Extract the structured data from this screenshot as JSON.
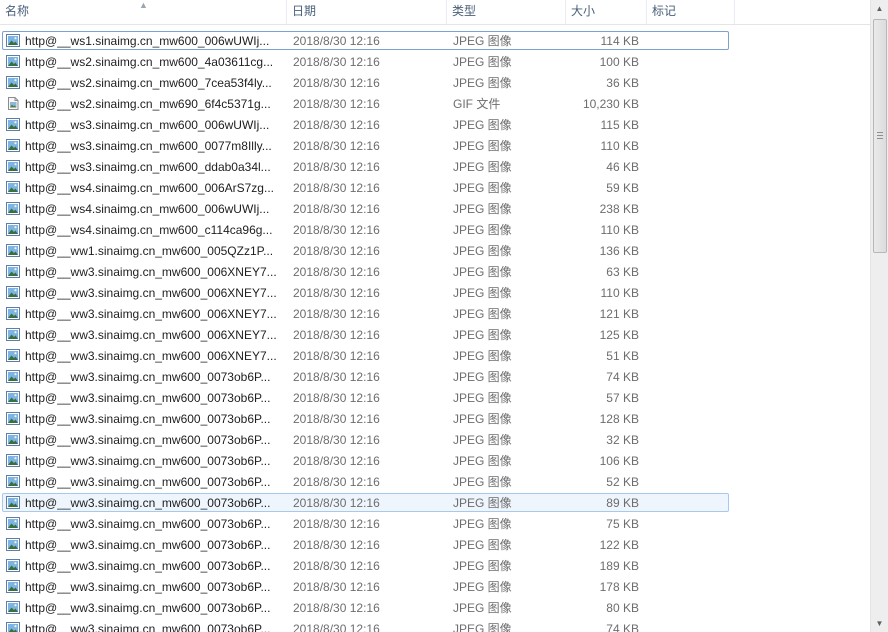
{
  "columns": {
    "name": "名称",
    "date": "日期",
    "type": "类型",
    "size": "大小",
    "tags": "标记"
  },
  "rows": [
    {
      "name": "http@__ws1.sinaimg.cn_mw600_006wUWIj...",
      "date": "2018/8/30 12:16",
      "type": "JPEG 图像",
      "size": "114 KB",
      "icon": "jpeg-image-icon",
      "state": "selected"
    },
    {
      "name": "http@__ws2.sinaimg.cn_mw600_4a03611cg...",
      "date": "2018/8/30 12:16",
      "type": "JPEG 图像",
      "size": "100 KB",
      "icon": "jpeg-image-icon"
    },
    {
      "name": "http@__ws2.sinaimg.cn_mw600_7cea53f4ly...",
      "date": "2018/8/30 12:16",
      "type": "JPEG 图像",
      "size": "36 KB",
      "icon": "jpeg-image-icon"
    },
    {
      "name": "http@__ws2.sinaimg.cn_mw690_6f4c5371g...",
      "date": "2018/8/30 12:16",
      "type": "GIF 文件",
      "size": "10,230 KB",
      "icon": "gif-file-icon"
    },
    {
      "name": "http@__ws3.sinaimg.cn_mw600_006wUWIj...",
      "date": "2018/8/30 12:16",
      "type": "JPEG 图像",
      "size": "115 KB",
      "icon": "jpeg-image-icon"
    },
    {
      "name": "http@__ws3.sinaimg.cn_mw600_0077m8Illy...",
      "date": "2018/8/30 12:16",
      "type": "JPEG 图像",
      "size": "110 KB",
      "icon": "jpeg-image-icon"
    },
    {
      "name": "http@__ws3.sinaimg.cn_mw600_ddab0a34l...",
      "date": "2018/8/30 12:16",
      "type": "JPEG 图像",
      "size": "46 KB",
      "icon": "jpeg-image-icon"
    },
    {
      "name": "http@__ws4.sinaimg.cn_mw600_006ArS7zg...",
      "date": "2018/8/30 12:16",
      "type": "JPEG 图像",
      "size": "59 KB",
      "icon": "jpeg-image-icon"
    },
    {
      "name": "http@__ws4.sinaimg.cn_mw600_006wUWIj...",
      "date": "2018/8/30 12:16",
      "type": "JPEG 图像",
      "size": "238 KB",
      "icon": "jpeg-image-icon"
    },
    {
      "name": "http@__ws4.sinaimg.cn_mw600_c114ca96g...",
      "date": "2018/8/30 12:16",
      "type": "JPEG 图像",
      "size": "110 KB",
      "icon": "jpeg-image-icon"
    },
    {
      "name": "http@__ww1.sinaimg.cn_mw600_005QZz1P...",
      "date": "2018/8/30 12:16",
      "type": "JPEG 图像",
      "size": "136 KB",
      "icon": "jpeg-image-icon"
    },
    {
      "name": "http@__ww3.sinaimg.cn_mw600_006XNEY7...",
      "date": "2018/8/30 12:16",
      "type": "JPEG 图像",
      "size": "63 KB",
      "icon": "jpeg-image-icon"
    },
    {
      "name": "http@__ww3.sinaimg.cn_mw600_006XNEY7...",
      "date": "2018/8/30 12:16",
      "type": "JPEG 图像",
      "size": "110 KB",
      "icon": "jpeg-image-icon"
    },
    {
      "name": "http@__ww3.sinaimg.cn_mw600_006XNEY7...",
      "date": "2018/8/30 12:16",
      "type": "JPEG 图像",
      "size": "121 KB",
      "icon": "jpeg-image-icon"
    },
    {
      "name": "http@__ww3.sinaimg.cn_mw600_006XNEY7...",
      "date": "2018/8/30 12:16",
      "type": "JPEG 图像",
      "size": "125 KB",
      "icon": "jpeg-image-icon"
    },
    {
      "name": "http@__ww3.sinaimg.cn_mw600_006XNEY7...",
      "date": "2018/8/30 12:16",
      "type": "JPEG 图像",
      "size": "51 KB",
      "icon": "jpeg-image-icon"
    },
    {
      "name": "http@__ww3.sinaimg.cn_mw600_0073ob6P...",
      "date": "2018/8/30 12:16",
      "type": "JPEG 图像",
      "size": "74 KB",
      "icon": "jpeg-image-icon"
    },
    {
      "name": "http@__ww3.sinaimg.cn_mw600_0073ob6P...",
      "date": "2018/8/30 12:16",
      "type": "JPEG 图像",
      "size": "57 KB",
      "icon": "jpeg-image-icon"
    },
    {
      "name": "http@__ww3.sinaimg.cn_mw600_0073ob6P...",
      "date": "2018/8/30 12:16",
      "type": "JPEG 图像",
      "size": "128 KB",
      "icon": "jpeg-image-icon"
    },
    {
      "name": "http@__ww3.sinaimg.cn_mw600_0073ob6P...",
      "date": "2018/8/30 12:16",
      "type": "JPEG 图像",
      "size": "32 KB",
      "icon": "jpeg-image-icon"
    },
    {
      "name": "http@__ww3.sinaimg.cn_mw600_0073ob6P...",
      "date": "2018/8/30 12:16",
      "type": "JPEG 图像",
      "size": "106 KB",
      "icon": "jpeg-image-icon"
    },
    {
      "name": "http@__ww3.sinaimg.cn_mw600_0073ob6P...",
      "date": "2018/8/30 12:16",
      "type": "JPEG 图像",
      "size": "52 KB",
      "icon": "jpeg-image-icon"
    },
    {
      "name": "http@__ww3.sinaimg.cn_mw600_0073ob6P...",
      "date": "2018/8/30 12:16",
      "type": "JPEG 图像",
      "size": "89 KB",
      "icon": "jpeg-image-icon",
      "state": "hover"
    },
    {
      "name": "http@__ww3.sinaimg.cn_mw600_0073ob6P...",
      "date": "2018/8/30 12:16",
      "type": "JPEG 图像",
      "size": "75 KB",
      "icon": "jpeg-image-icon"
    },
    {
      "name": "http@__ww3.sinaimg.cn_mw600_0073ob6P...",
      "date": "2018/8/30 12:16",
      "type": "JPEG 图像",
      "size": "122 KB",
      "icon": "jpeg-image-icon"
    },
    {
      "name": "http@__ww3.sinaimg.cn_mw600_0073ob6P...",
      "date": "2018/8/30 12:16",
      "type": "JPEG 图像",
      "size": "189 KB",
      "icon": "jpeg-image-icon"
    },
    {
      "name": "http@__ww3.sinaimg.cn_mw600_0073ob6P...",
      "date": "2018/8/30 12:16",
      "type": "JPEG 图像",
      "size": "178 KB",
      "icon": "jpeg-image-icon"
    },
    {
      "name": "http@__ww3.sinaimg.cn_mw600_0073ob6P...",
      "date": "2018/8/30 12:16",
      "type": "JPEG 图像",
      "size": "80 KB",
      "icon": "jpeg-image-icon"
    },
    {
      "name": "http@__ww3.sinaimg.cn_mw600_0073ob6P...",
      "date": "2018/8/30 12:16",
      "type": "JPEG 图像",
      "size": "74 KB",
      "icon": "jpeg-image-icon"
    }
  ],
  "scrollbar": {
    "up_icon": "arrow-up-icon",
    "down_icon": "arrow-down-icon"
  }
}
